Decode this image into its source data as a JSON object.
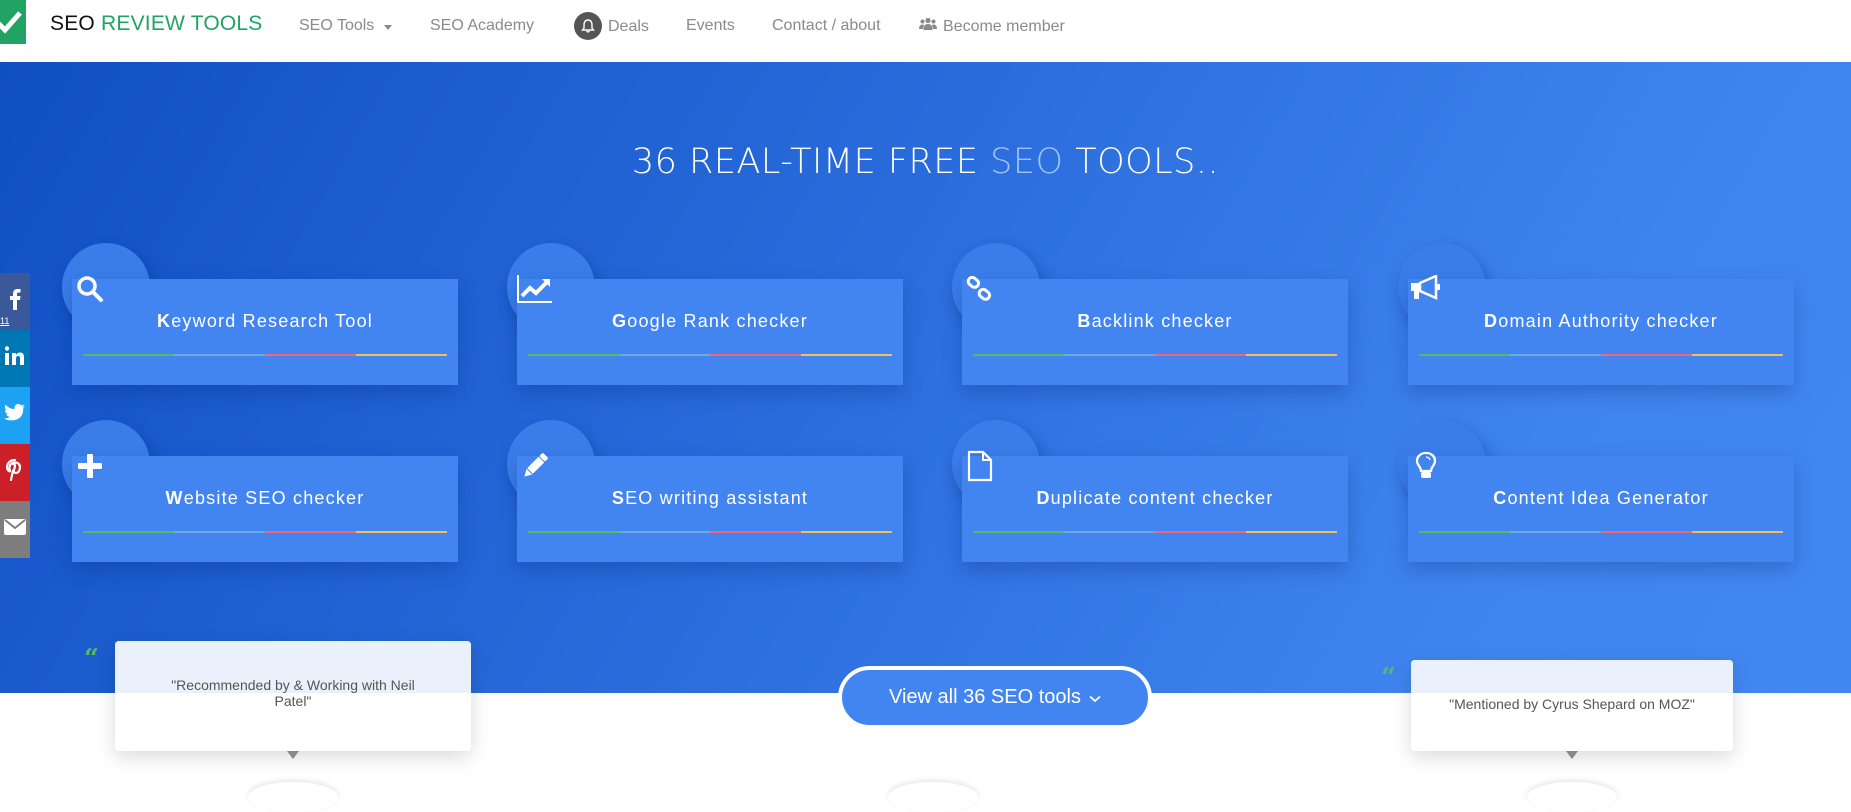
{
  "navbar": {
    "brand_part1": "SEO",
    "brand_part2": "REVIEW TOOLS",
    "items": [
      {
        "label": "SEO Tools",
        "has_dropdown": true
      },
      {
        "label": "SEO Academy"
      },
      {
        "label": "Deals",
        "icon": "bell-icon"
      },
      {
        "label": "Events"
      },
      {
        "label": "Contact / about"
      },
      {
        "label": "Become member",
        "icon": "users-icon"
      }
    ]
  },
  "hero": {
    "title_part1": "36 REAL-TIME FREE",
    "title_accent": "SEO",
    "title_part2": "TOOLS.."
  },
  "tools": [
    {
      "initial": "K",
      "rest": "eyword Research Tool",
      "icon": "search-icon"
    },
    {
      "initial": "G",
      "rest": "oogle Rank checker",
      "icon": "line-chart-icon"
    },
    {
      "initial": "B",
      "rest": "acklink checker",
      "icon": "link-icon"
    },
    {
      "initial": "D",
      "rest": "omain Authority checker",
      "icon": "megaphone-icon"
    },
    {
      "initial": "W",
      "rest": "ebsite SEO checker",
      "icon": "plus-icon"
    },
    {
      "initial": "S",
      "rest": "EO writing assistant",
      "icon": "pencil-icon"
    },
    {
      "initial": "D",
      "rest": "uplicate content checker",
      "icon": "file-icon"
    },
    {
      "initial": "C",
      "rest": "ontent Idea Generator",
      "icon": "lightbulb-icon"
    }
  ],
  "bar_colors": [
    "#5cb85c",
    "#6fa8dc",
    "#f06677",
    "#f0c05a"
  ],
  "social": {
    "facebook_count": "11",
    "items": [
      "facebook",
      "linkedin",
      "twitter",
      "pinterest",
      "email"
    ]
  },
  "testimonials": [
    {
      "text": "\"Recommended by & Working with Neil Patel\""
    },
    {
      "text": "\"Mentioned by Cyrus Shepard on MOZ\""
    }
  ],
  "view_all_button": "View all 36 SEO tools",
  "colors": {
    "brand_green": "#21a366",
    "hero_blue": "#4285f0",
    "quote_green": "#5cb85c"
  }
}
